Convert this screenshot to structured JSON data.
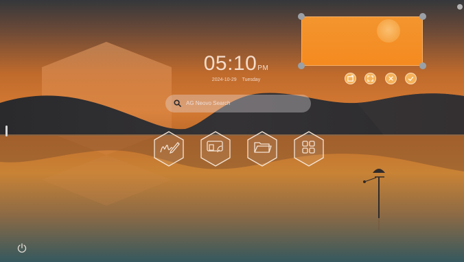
{
  "clock": {
    "time": "05:10",
    "ampm": "PM",
    "date": "2024-10-29",
    "weekday": "Tuesday"
  },
  "search": {
    "placeholder": "AG Neovo Search"
  },
  "apps": [
    {
      "icon": "whiteboard-pen-icon"
    },
    {
      "icon": "screen-cast-icon"
    },
    {
      "icon": "folder-icon"
    },
    {
      "icon": "apps-grid-icon"
    }
  ],
  "widget": {
    "buttons": [
      "replace-icon",
      "fullscreen-icon",
      "close-icon",
      "confirm-check-icon"
    ]
  },
  "colors": {
    "accent": "#f5a33b",
    "sun": "#f7b062",
    "sky_top": "#3b3a3d",
    "sky_mid": "#c36a2a"
  }
}
